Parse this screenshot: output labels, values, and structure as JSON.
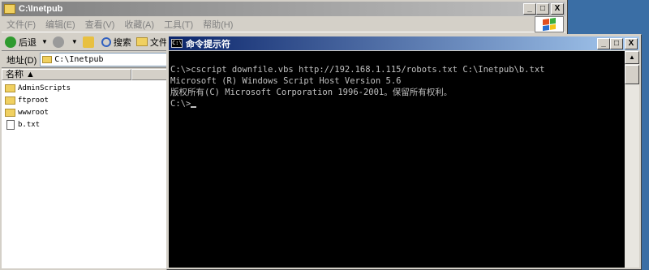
{
  "explorer": {
    "title": "C:\\Inetpub",
    "menu": [
      "文件(F)",
      "编辑(E)",
      "查看(V)",
      "收藏(A)",
      "工具(T)",
      "帮助(H)"
    ],
    "toolbar": {
      "back_label": "后退",
      "search_label": "搜索",
      "folders_label": "文件"
    },
    "address": {
      "label": "地址(D)",
      "value": "C:\\Inetpub"
    },
    "column_name": "名称 ▲",
    "items": [
      {
        "name": "AdminScripts",
        "type": "folder"
      },
      {
        "name": "ftproot",
        "type": "folder"
      },
      {
        "name": "wwwroot",
        "type": "folder"
      },
      {
        "name": "b.txt",
        "type": "file"
      }
    ]
  },
  "cmd": {
    "title": "命令提示符",
    "icon_text": "C:\\",
    "lines": [
      "C:\\>cscript downfile.vbs http://192.168.1.115/robots.txt C:\\Inetpub\\b.txt",
      "Microsoft (R) Windows Script Host Version 5.6",
      "版权所有(C) Microsoft Corporation 1996-2001。保留所有权利。",
      "",
      "C:\\>"
    ]
  },
  "window_buttons": {
    "minimize": "_",
    "maximize": "□",
    "close": "X"
  },
  "colors": {
    "titlebar_active": "#0a246a",
    "console_bg": "#000000",
    "console_fg": "#c0c0c0"
  }
}
